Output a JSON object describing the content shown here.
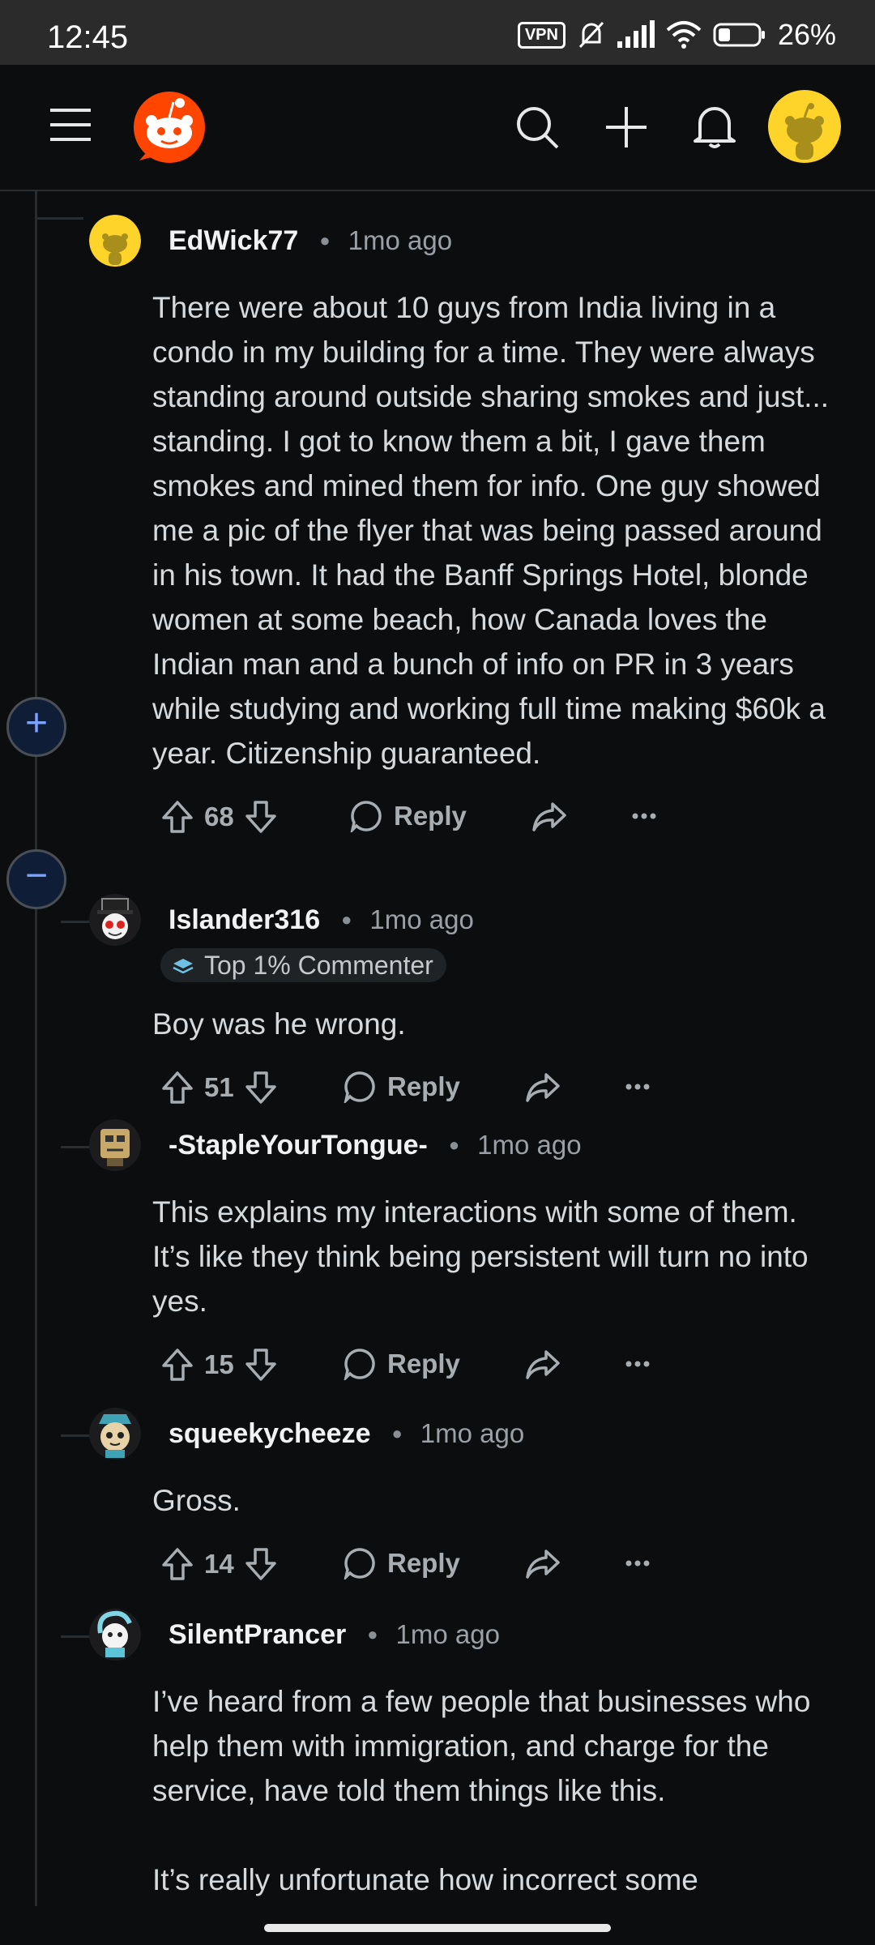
{
  "status_bar": {
    "time": "12:45",
    "vpn": "VPN",
    "battery": "26%"
  },
  "header": {
    "menu_icon": "hamburger-icon",
    "logo_icon": "reddit-logo",
    "search_icon": "search-icon",
    "create_icon": "plus-icon",
    "notifications_icon": "bell-icon",
    "avatar_icon": "snoo-avatar"
  },
  "colors": {
    "background": "#0b0d0f",
    "accent": "#ff4500",
    "text": "#d7dadc",
    "muted": "#9aa0a6"
  },
  "comments": [
    {
      "user": "EdWick77",
      "time": "1mo ago",
      "body": "There were about 10 guys from India living in a condo in my building for a time. They were always standing around outside sharing smokes and just... standing. I got to know them a bit, I gave them smokes and mined them for info. One guy showed me a pic of the flyer that was being passed around in his town. It had the Banff Springs Hotel, blonde women at some beach, how Canada loves the Indian man and a bunch of info on PR in 3 years while studying and working full time making $60k a year. Citizenship guaranteed.",
      "votes": "68",
      "reply": "Reply"
    },
    {
      "user": "Islander316",
      "time": "1mo ago",
      "flair": "Top 1% Commenter",
      "body": "Boy was he wrong.",
      "votes": "51",
      "reply": "Reply"
    },
    {
      "user": "-StapleYourTongue-",
      "time": "1mo ago",
      "body": "This explains my interactions with some of them. It’s like they think being persistent will turn no into yes.",
      "votes": "15",
      "reply": "Reply"
    },
    {
      "user": "squeekycheeze",
      "time": "1mo ago",
      "body": "Gross.",
      "votes": "14",
      "reply": "Reply"
    },
    {
      "user": "SilentPrancer",
      "time": "1mo ago",
      "body": "I’ve heard from a few people that businesses who help them with immigration, and charge for the service, have told them things like this.\n\nIt’s really unfortunate how incorrect some"
    }
  ]
}
